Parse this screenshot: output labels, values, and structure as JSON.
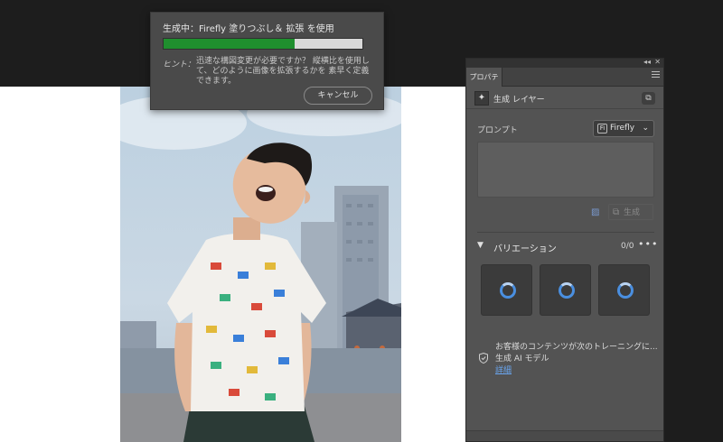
{
  "progress_dialog": {
    "title": "生成中：Firefly 塗りつぶし＆ 拡張 を使用",
    "progress_percent": 66,
    "hint_label": "ヒント：",
    "hint_text": "迅速な構図変更が必要ですか？ 縦横比を使用して、どのように画像を拡張するかを 素早く定義できます。",
    "cancel_label": "キャンセル",
    "fill_color": "#1f8f2e"
  },
  "panel": {
    "tab_label": "プロパティ",
    "layer": {
      "icon": "generative-layer-icon",
      "label": "生成 レイヤー"
    },
    "prompt_label": "プロンプト",
    "prompt_value": "",
    "model_select": {
      "icon": "firefly-icon",
      "value": "Firefly"
    },
    "generate_label": "生成",
    "variations": {
      "title": "バリエーション",
      "count": "0/0",
      "tiles": 3
    },
    "notice": {
      "line1": "お客様のコンテンツが次のトレーニングに...",
      "line2": "生成 AI モデル",
      "link": "詳細"
    }
  },
  "colors": {
    "accent": "#4a8fe0",
    "link": "#6aa6f0",
    "panel_bg": "#535353"
  }
}
